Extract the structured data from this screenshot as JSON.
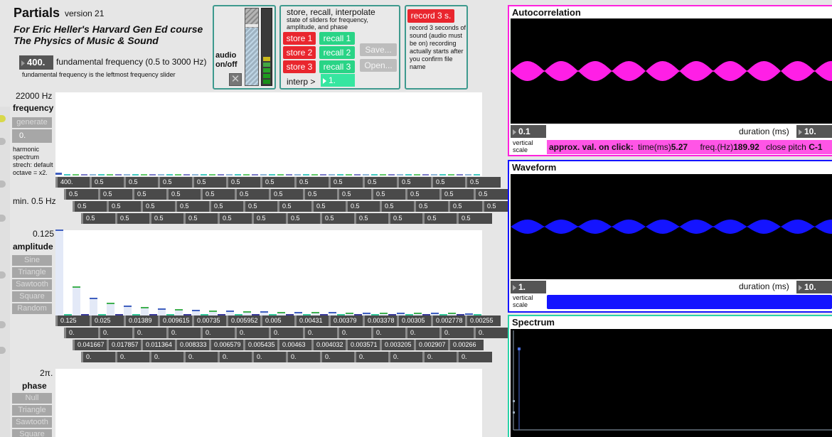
{
  "header": {
    "title": "Partials",
    "version": "version 21",
    "course_line1": "For Eric Heller's Harvard Gen Ed course",
    "course_line2": "The Physics of Music & Sound"
  },
  "fundamental": {
    "value": "400.",
    "label": "fundamental frequency (0.5 to 3000 Hz)",
    "note": "fundamental frequency is the leftmost frequency slider"
  },
  "audio": {
    "label_line1": "audio",
    "label_line2": "on/off",
    "toggle_glyph": "✕",
    "volume_level": 0.8
  },
  "store": {
    "title": "store, recall, interpolate",
    "subtitle": "state of sliders for frequency, amplitude, and phase",
    "store_buttons": [
      "store 1",
      "store 2",
      "store 3"
    ],
    "recall_buttons": [
      "recall 1",
      "recall 2",
      "recall 3"
    ],
    "save_label": "Save...",
    "open_label": "Open...",
    "interp_label": "interp >",
    "interp_value": "1."
  },
  "record": {
    "button_label": "record 3 s.",
    "description": "record 3 seconds of sound (audio must be on) recording actually starts after you confirm file name"
  },
  "frequency": {
    "max_label": "22000 Hz",
    "title": "frequency",
    "generate_label": "generate",
    "stretch_value": "0.",
    "stretch_note": "harmonic spectrum strech: default octave = x2.",
    "min_label": "min. 0.5 Hz",
    "row1": [
      "400.",
      "0.5",
      "0.5",
      "0.5",
      "0.5",
      "0.5",
      "0.5",
      "0.5",
      "0.5",
      "0.5",
      "0.5",
      "0.5",
      "0.5"
    ],
    "row2": [
      "0.5",
      "0.5",
      "0.5",
      "0.5",
      "0.5",
      "0.5",
      "0.5",
      "0.5",
      "0.5",
      "0.5",
      "0.5",
      "0.5",
      "0.5"
    ],
    "row3": [
      "0.5",
      "0.5",
      "0.5",
      "0.5",
      "0.5",
      "0.5",
      "0.5",
      "0.5",
      "0.5",
      "0.5",
      "0.5",
      "0.5",
      "0.5"
    ],
    "row4": [
      "0.5",
      "0.5",
      "0.5",
      "0.5",
      "0.5",
      "0.5",
      "0.5",
      "0.5",
      "0.5",
      "0.5",
      "0.5",
      "0.5"
    ]
  },
  "amplitude": {
    "max_label": "0.125",
    "title": "amplitude",
    "presets": [
      "Sine",
      "Triangle",
      "Sawtooth",
      "Square",
      "Random"
    ],
    "row1": [
      "0.125",
      "0.025",
      "0.01389",
      "0.009615",
      "0.00735",
      "0.005952",
      "0.005",
      "0.00431",
      "0.00379",
      "0.003378",
      "0.00305",
      "0.002778",
      "0.00255"
    ],
    "row2": [
      "0.",
      "0.",
      "0.",
      "0.",
      "0.",
      "0.",
      "0.",
      "0.",
      "0.",
      "0.",
      "0.",
      "0.",
      "0."
    ],
    "row3": [
      "0.041667",
      "0.017857",
      "0.011364",
      "0.008333",
      "0.006579",
      "0.005435",
      "0.00463",
      "0.004032",
      "0.003571",
      "0.003205",
      "0.002907",
      "0.00266"
    ],
    "row4": [
      "0.",
      "0.",
      "0.",
      "0.",
      "0.",
      "0.",
      "0.",
      "0.",
      "0.",
      "0.",
      "0.",
      "0."
    ]
  },
  "phase": {
    "max_label": "2π.",
    "title": "phase",
    "presets": [
      "Null",
      "Triangle",
      "Sawtooth",
      "Square"
    ]
  },
  "autocorrelation": {
    "title": "Autocorrelation",
    "vscale_value": "0.1",
    "vscale_label": "vertical scale",
    "duration_label": "duration (ms)",
    "duration_value": "10.",
    "info_label": "approx. val. on click:",
    "time_label": "time(ms)",
    "time_value": "5.27",
    "freq_label": "freq.(Hz)",
    "freq_value": "189.92",
    "pitch_label": "close pitch",
    "pitch_value": "C-1",
    "color": "#ff1fe6"
  },
  "waveform": {
    "title": "Waveform",
    "vscale_value": "1.",
    "vscale_label": "vertical scale",
    "duration_label": "duration (ms)",
    "duration_value": "10.",
    "color": "#1414ff"
  },
  "spectrum": {
    "title": "Spectrum"
  }
}
